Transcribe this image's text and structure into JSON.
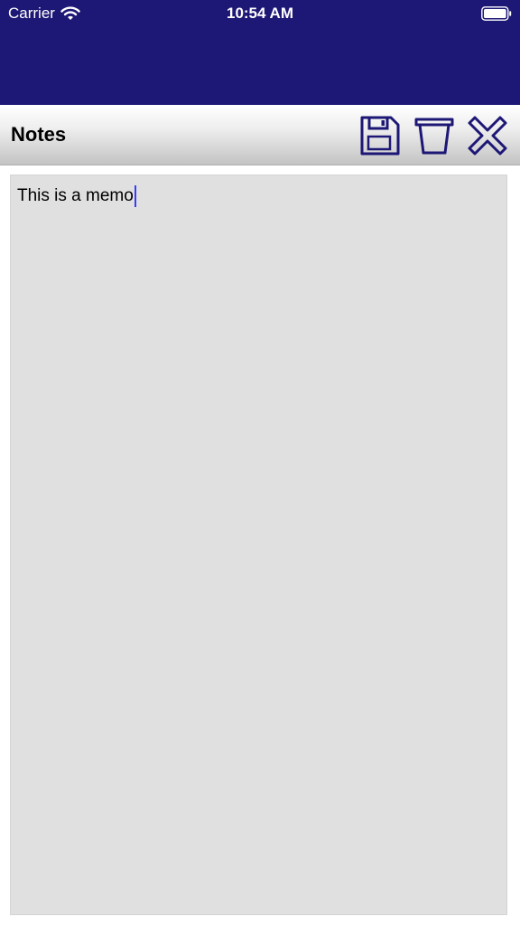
{
  "status_bar": {
    "carrier": "Carrier",
    "time": "10:54 AM",
    "icons": [
      "wifi-icon",
      "battery-icon"
    ]
  },
  "toolbar": {
    "title": "Notes",
    "actions": [
      {
        "icon": "floppy-disk-icon"
      },
      {
        "icon": "trash-can-icon"
      },
      {
        "icon": "close-x-icon"
      }
    ]
  },
  "memo": {
    "text": "This is a memo"
  },
  "colors": {
    "header_bg": "#1d1775",
    "icon": "#1d1775",
    "memo_bg": "#e0e0e0",
    "caret": "#3b3bff"
  }
}
